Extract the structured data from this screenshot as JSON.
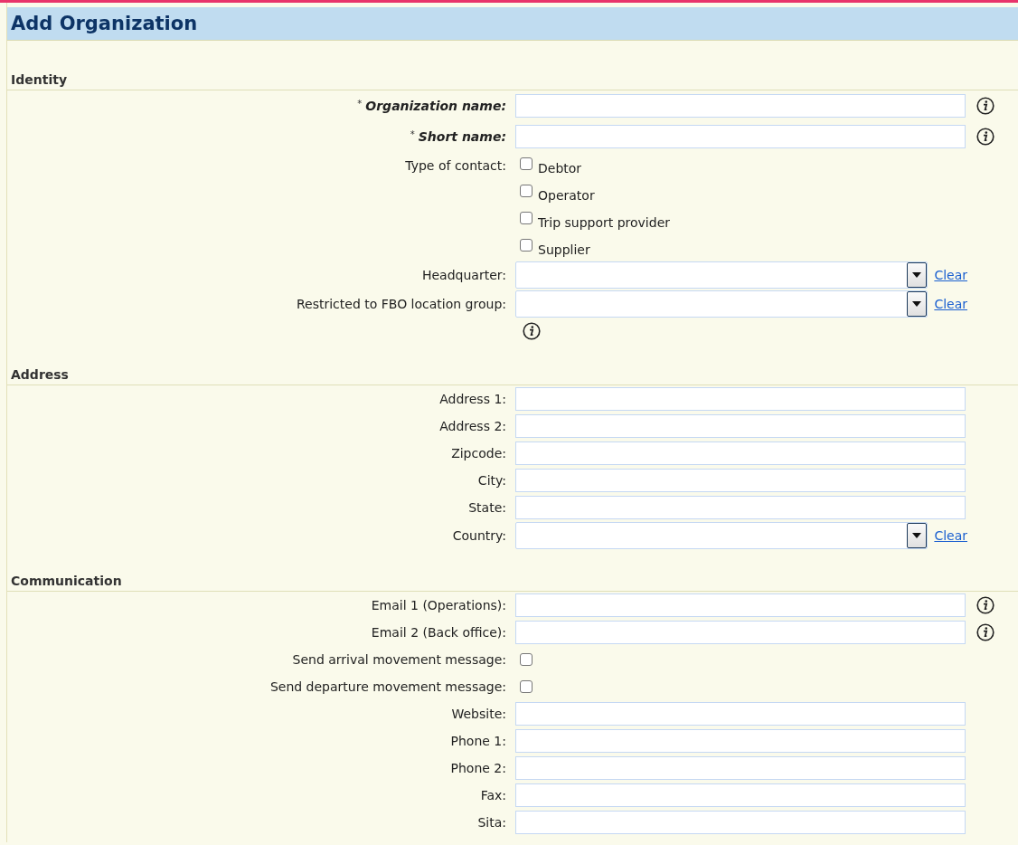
{
  "title": "Add Organization",
  "sections": [
    {
      "title": "Identity",
      "rows": [
        {
          "kind": "text",
          "label": "Organization name:",
          "required_mark": "*",
          "info": true
        },
        {
          "kind": "text",
          "label": "Short name:",
          "required_mark": "*",
          "info": true
        },
        {
          "kind": "checkbox_group",
          "label": "Type of contact:",
          "options": [
            {
              "label": "Debtor",
              "checked": false
            },
            {
              "label": "Operator",
              "checked": false
            },
            {
              "label": "Trip support provider",
              "checked": false
            },
            {
              "label": "Supplier",
              "checked": false
            }
          ]
        },
        {
          "kind": "select",
          "label": "Headquarter:",
          "clear": "Clear"
        },
        {
          "kind": "select",
          "label": "Restricted to FBO location group:",
          "clear": "Clear",
          "info_below": true
        }
      ]
    },
    {
      "title": "Address",
      "rows": [
        {
          "kind": "text",
          "label": "Address 1:",
          "info": false
        },
        {
          "kind": "text",
          "label": "Address 2:",
          "info": false
        },
        {
          "kind": "text",
          "label": "Zipcode:",
          "info": false
        },
        {
          "kind": "text",
          "label": "City:",
          "info": false
        },
        {
          "kind": "text",
          "label": "State:",
          "info": false
        },
        {
          "kind": "select",
          "label": "Country:",
          "clear": "Clear"
        }
      ]
    },
    {
      "title": "Communication",
      "rows": [
        {
          "kind": "text",
          "label": "Email 1 (Operations):",
          "info": true
        },
        {
          "kind": "text",
          "label": "Email 2 (Back office):",
          "info": true
        },
        {
          "kind": "checkbox",
          "label": "Send arrival movement message:",
          "checked": false
        },
        {
          "kind": "checkbox",
          "label": "Send departure movement message:",
          "checked": false
        },
        {
          "kind": "text",
          "label": "Website:",
          "info": false
        },
        {
          "kind": "text",
          "label": "Phone 1:",
          "info": false
        },
        {
          "kind": "text",
          "label": "Phone 2:",
          "info": false
        },
        {
          "kind": "text",
          "label": "Fax:",
          "info": false
        },
        {
          "kind": "text",
          "label": "Sita:",
          "info": false
        }
      ]
    }
  ]
}
